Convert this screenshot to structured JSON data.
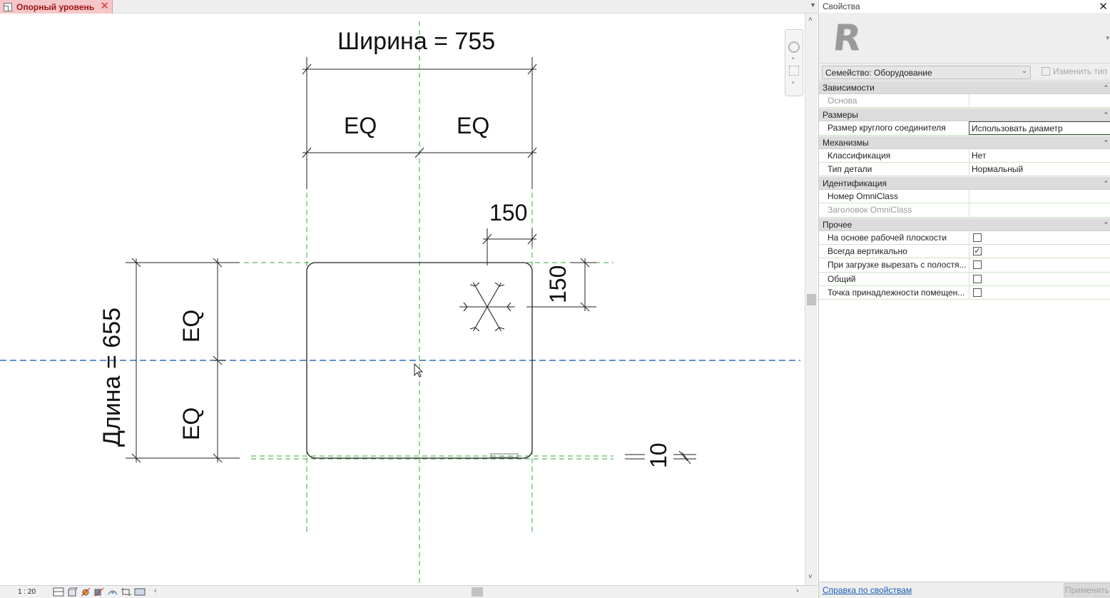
{
  "view_tab": {
    "label": "Опорный уровень",
    "close": "✕",
    "menu_arrow": "▾"
  },
  "drawing": {
    "width_label": "Ширина = 755",
    "length_label": "Длина = 655",
    "eq_label": "EQ",
    "dim_offset_h": "150",
    "dim_offset_v": "150",
    "dim_thickness": "10"
  },
  "status_bar": {
    "scale": "1 : 20",
    "scroll_left": "‹",
    "scroll_right": "›"
  },
  "scrollbar": {
    "up": "˄",
    "down": "˅"
  },
  "properties": {
    "title": "Свойства",
    "close": "✕",
    "logo_letter": "R",
    "family_select": "Семейство: Оборудование",
    "edit_type": "Изменить тип",
    "groups": [
      {
        "name": "Зависимости",
        "rows": [
          {
            "name": "Основа",
            "value": "",
            "muted": true
          }
        ]
      },
      {
        "name": "Размеры",
        "rows": [
          {
            "name": "Размер круглого соединителя",
            "value": "Использовать диаметр",
            "editing": true
          }
        ]
      },
      {
        "name": "Механизмы",
        "rows": [
          {
            "name": "Классификация",
            "value": "Нет"
          },
          {
            "name": "Тип детали",
            "value": "Нормальный"
          }
        ]
      },
      {
        "name": "Идентификация",
        "rows": [
          {
            "name": "Номер OmniClass",
            "value": ""
          },
          {
            "name": "Заголовок OmniClass",
            "value": "",
            "muted": true
          }
        ]
      },
      {
        "name": "Прочее",
        "rows": [
          {
            "name": "На основе рабочей плоскости",
            "checkbox": true,
            "checked": false
          },
          {
            "name": "Всегда вертикально",
            "checkbox": true,
            "checked": true
          },
          {
            "name": "При загрузке вырезать с полостя...",
            "checkbox": true,
            "checked": false
          },
          {
            "name": "Общий",
            "checkbox": true,
            "checked": false
          },
          {
            "name": "Точка принадлежности помещен...",
            "checkbox": true,
            "checked": false
          }
        ]
      }
    ],
    "help_link": "Справка по свойствам",
    "apply_button": "Применить"
  },
  "colors": {
    "tab_background": "#f6c7c9",
    "tab_text": "#9a1414",
    "reference_plane": "#3aa53a",
    "center_plane": "#2f6fb5",
    "link": "#1a5fb4"
  }
}
